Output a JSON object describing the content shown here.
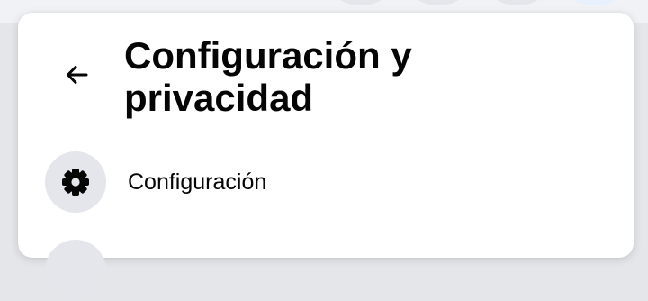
{
  "colors": {
    "panel_background": "#ffffff",
    "page_background": "#f0f2f5",
    "primary_text": "#050505",
    "icon_circle": "#e4e6eb"
  },
  "header": {
    "back_icon": "arrow-left-icon",
    "title": "Configuración y privacidad"
  },
  "menu": {
    "items": [
      {
        "icon": "gear-icon",
        "label": "Configuración"
      }
    ]
  }
}
